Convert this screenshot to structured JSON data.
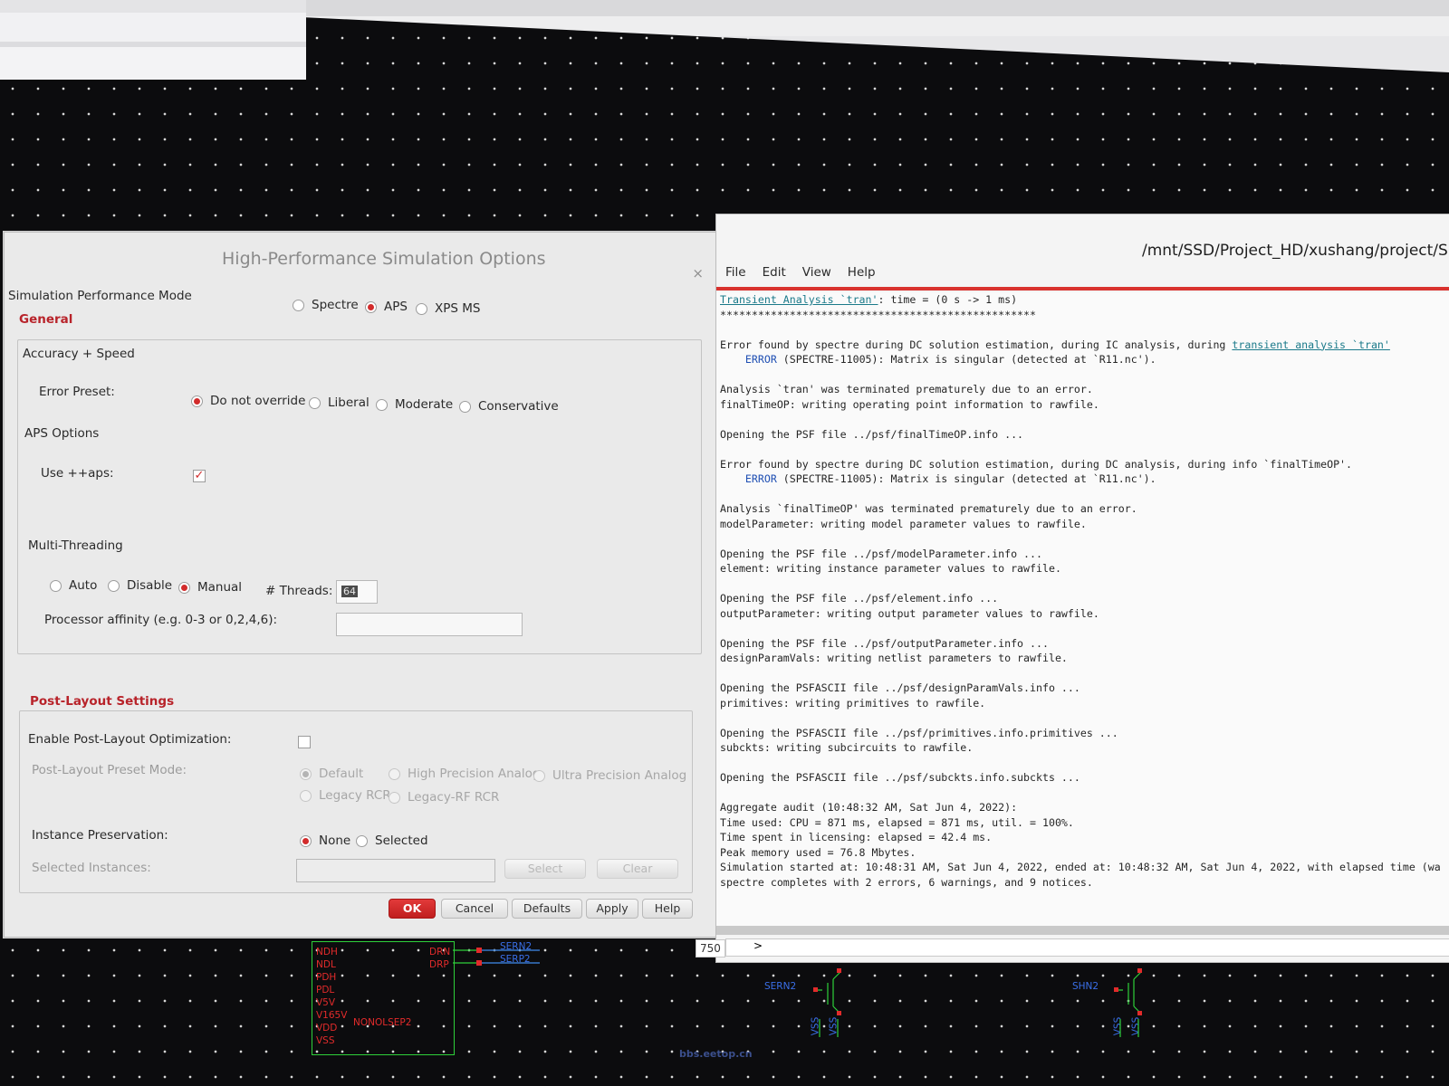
{
  "dialog": {
    "title": "High-Performance Simulation Options",
    "close_glyph": "×",
    "sim_mode_label": "Simulation Performance Mode",
    "sim_modes": [
      "Spectre",
      "APS",
      "XPS MS"
    ],
    "general_label": "General",
    "accuracy_label": "Accuracy + Speed",
    "error_preset_label": "Error Preset:",
    "error_presets": [
      "Do not override",
      "Liberal",
      "Moderate",
      "Conservative"
    ],
    "aps_options_label": "APS Options",
    "use_aps_label": "Use ++aps:",
    "multithreading_label": "Multi-Threading",
    "thread_modes": [
      "Auto",
      "Disable",
      "Manual"
    ],
    "threads_label": "# Threads:",
    "threads_value": "64",
    "affinity_label": "Processor affinity (e.g. 0-3 or 0,2,4,6):",
    "post_layout_label": "Post-Layout Settings",
    "enable_post_layout_label": "Enable Post-Layout Optimization:",
    "post_layout_preset_label": "Post-Layout Preset Mode:",
    "post_layout_presets": [
      "Default",
      "High Precision Analog",
      "Ultra Precision Analog",
      "Legacy RCR",
      "Legacy-RF RCR"
    ],
    "instance_preservation_label": "Instance Preservation:",
    "instance_options": [
      "None",
      "Selected"
    ],
    "selected_instances_label": "Selected Instances:",
    "select_btn": "Select",
    "clear_btn": "Clear",
    "buttons": {
      "ok": "OK",
      "cancel": "Cancel",
      "defaults": "Defaults",
      "apply": "Apply",
      "help": "Help"
    }
  },
  "log": {
    "title": "/mnt/SSD/Project_HD/xushang/project/Si",
    "menu": [
      "File",
      "Edit",
      "View",
      "Help"
    ],
    "line_number": "750",
    "prompt": ">",
    "link_tran": "Transient Analysis `tran'",
    "tran_rest": ": time = (0 s -> 1 ms)",
    "stars": "**************************************************",
    "err1_a": "Error found by spectre during DC solution estimation, during IC analysis, during ",
    "err1_link": "transient analysis `tran'",
    "error_word": "ERROR",
    "err1_b": " (SPECTRE-11005): Matrix is singular (detected at `R11.nc').",
    "l1": "Analysis `tran' was terminated prematurely due to an error.",
    "l2": "finalTimeOP: writing operating point information to rawfile.",
    "l3": "Opening the PSF file ../psf/finalTimeOP.info ...",
    "err2_a": "Error found by spectre during DC solution estimation, during DC analysis, during info `finalTimeOP'.",
    "err2_b": " (SPECTRE-11005): Matrix is singular (detected at `R11.nc').",
    "l4": "Analysis `finalTimeOP' was terminated prematurely due to an error.",
    "l5": "modelParameter: writing model parameter values to rawfile.",
    "l6": "Opening the PSF file ../psf/modelParameter.info ...",
    "l7": "element: writing instance parameter values to rawfile.",
    "l8": "Opening the PSF file ../psf/element.info ...",
    "l9": "outputParameter: writing output parameter values to rawfile.",
    "l10": "Opening the PSF file ../psf/outputParameter.info ...",
    "l11": "designParamVals: writing netlist parameters to rawfile.",
    "l12": "Opening the PSFASCII file ../psf/designParamVals.info ...",
    "l13": "primitives: writing primitives to rawfile.",
    "l14": "Opening the PSFASCII file ../psf/primitives.info.primitives ...",
    "l15": "subckts: writing subcircuits to rawfile.",
    "l16": "Opening the PSFASCII file ../psf/subckts.info.subckts ...",
    "l17": "Aggregate audit (10:48:32 AM, Sat Jun 4, 2022):",
    "l18": "Time used: CPU = 871 ms, elapsed = 871 ms, util. = 100%.",
    "l19": "Time spent in licensing: elapsed = 42.4 ms.",
    "l20": "Peak memory used = 76.8 Mbytes.",
    "l21": "Simulation started at: 10:48:31 AM, Sat Jun 4, 2022, ended at: 10:48:32 AM, Sat Jun 4, 2022, with elapsed time (wa",
    "l22": "spectre completes with 2 errors, 6 warnings, and 9 notices."
  },
  "schematic": {
    "left_pins": [
      "NDH",
      "NDL",
      "PDH",
      "PDL",
      "V5V",
      "V165V",
      "VDD",
      "VSS"
    ],
    "right_pins": [
      "DRN",
      "DRP"
    ],
    "cell_name": "NONOLSEP2",
    "nets": [
      "SERN2",
      "SERP2",
      "SERN2",
      "SHN2",
      "VSS",
      "VSS",
      "VSS",
      "VSS"
    ],
    "watermark": "bbs.eetop.cn"
  },
  "colors": {
    "accent": "#d22b2b",
    "section": "#b8232a",
    "link": "#1b7a8a",
    "error": "#1f4fb3",
    "wire": "#2ed03a"
  }
}
